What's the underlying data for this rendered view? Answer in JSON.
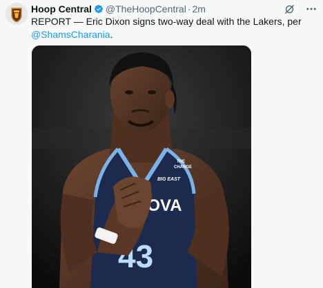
{
  "tweet": {
    "author_name": "Hoop Central",
    "handle": "@TheHoopCentral",
    "separator": "·",
    "time": "2m",
    "text": "REPORT — Eric Dixon signs two-way deal with the Lakers, per ",
    "mention": "@ShamsCharania",
    "text_end": "."
  },
  "icons": {
    "avatar": "hoop-central-logo",
    "verified": "verified-badge-icon",
    "grok": "grok-icon",
    "more": "more-icon"
  },
  "jersey": {
    "brand_line1": "THE",
    "brand_line2": "CHANGE",
    "conference": "BIG EAST",
    "team": "NOVA",
    "number": "43"
  },
  "colors": {
    "accent": "#1d9bf0",
    "jersey_navy": "#1c2a4d",
    "jersey_trim": "#7bb3e8"
  }
}
